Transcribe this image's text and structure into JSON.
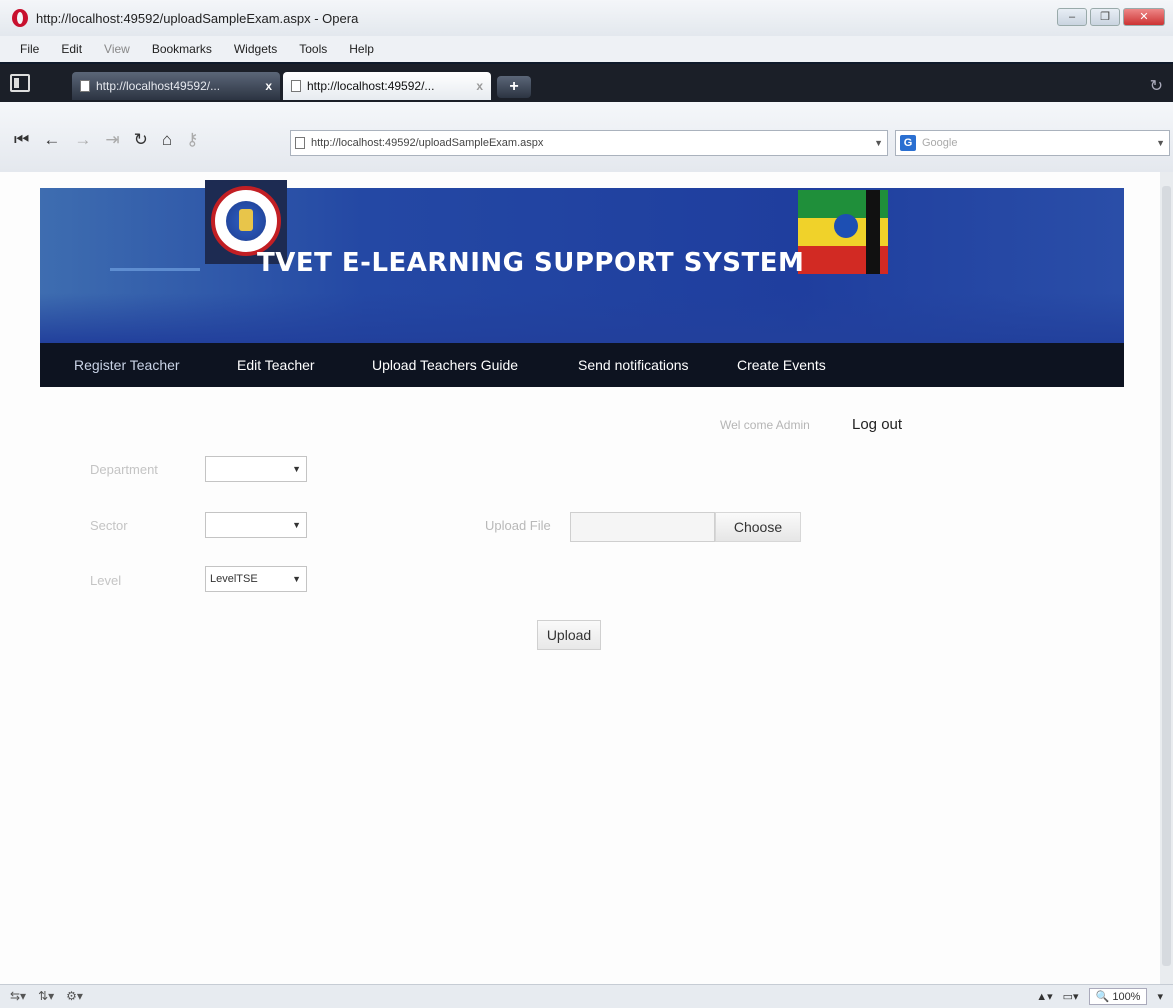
{
  "window": {
    "title": "http://localhost:49592/uploadSampleExam.aspx - Opera",
    "minimize": "–",
    "maximize": "❐",
    "close": "✕"
  },
  "menu": [
    "File",
    "Edit",
    "View",
    "Bookmarks",
    "Widgets",
    "Tools",
    "Help"
  ],
  "tabs": [
    {
      "label": "http://localhost49592/..."
    },
    {
      "label": "http://localhost:49592/..."
    }
  ],
  "tab_close": "x",
  "new_tab": "+",
  "toolbar": {
    "address": "http://localhost:49592/uploadSampleExam.aspx",
    "search_placeholder": "Google",
    "search_engine_letter": "G"
  },
  "header": {
    "site_title": "TVET E-LEARNING SUPPORT SYSTEM"
  },
  "nav": [
    {
      "label": "Register Teacher"
    },
    {
      "label": "Edit Teacher"
    },
    {
      "label": "Upload Teachers Guide"
    },
    {
      "label": "Send notifications"
    },
    {
      "label": "Create Events"
    }
  ],
  "user": {
    "welcome": "Wel come Admin",
    "logout": "Log out"
  },
  "form": {
    "department_label": "Department",
    "department_value": "",
    "sector_label": "Sector",
    "sector_value": "",
    "level_label": "Level",
    "level_value": "LevelTSE",
    "upload_file_label": "Upload File",
    "choose_label": "Choose",
    "upload_button": "Upload"
  },
  "status": {
    "zoom": "100%"
  },
  "colors": {
    "header_blue": "#1f3e9e",
    "nav_bg": "#0d1320",
    "opera_red": "#c8102e"
  }
}
